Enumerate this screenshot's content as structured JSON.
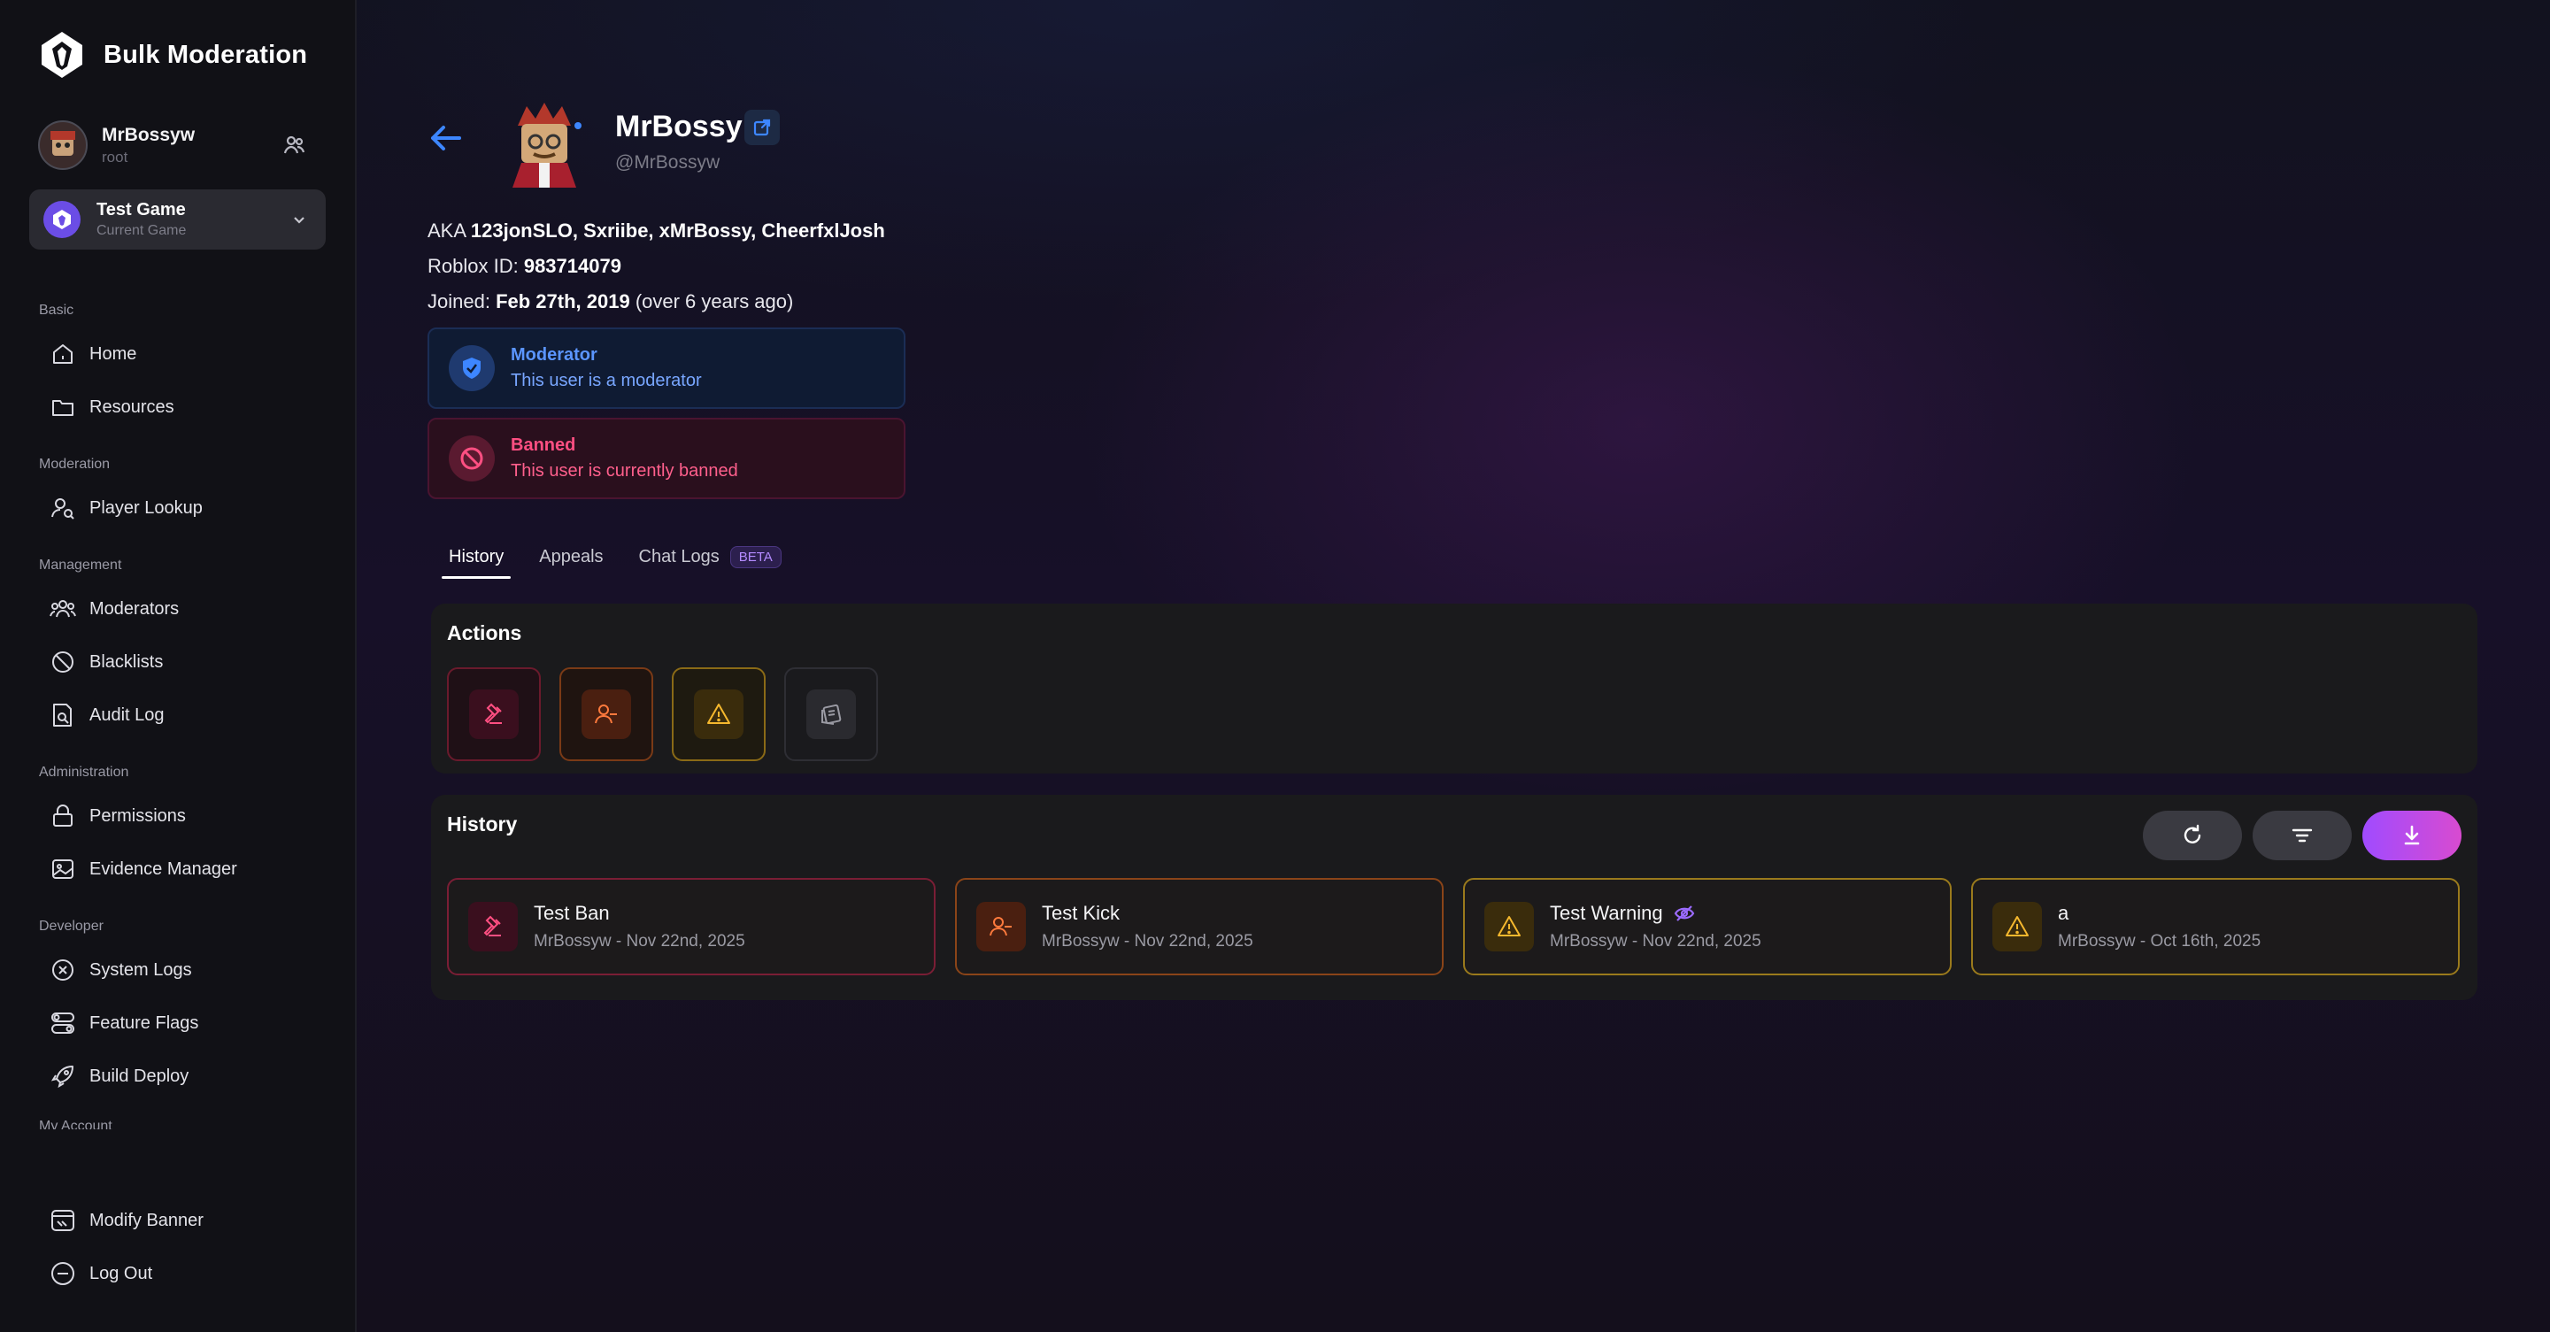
{
  "app": {
    "title": "Bulk Moderation"
  },
  "current_user": {
    "name": "MrBossyw",
    "role": "root"
  },
  "game": {
    "name": "Test Game",
    "subtitle": "Current Game"
  },
  "sidebar": {
    "sections": [
      {
        "label": "Basic",
        "items": [
          {
            "label": "Home",
            "icon": "home-icon"
          },
          {
            "label": "Resources",
            "icon": "folder-icon"
          }
        ]
      },
      {
        "label": "Moderation",
        "items": [
          {
            "label": "Player Lookup",
            "icon": "user-search-icon"
          }
        ]
      },
      {
        "label": "Management",
        "items": [
          {
            "label": "Moderators",
            "icon": "users-icon"
          },
          {
            "label": "Blacklists",
            "icon": "ban-icon"
          },
          {
            "label": "Audit Log",
            "icon": "audit-icon"
          }
        ]
      },
      {
        "label": "Administration",
        "items": [
          {
            "label": "Permissions",
            "icon": "lock-icon"
          },
          {
            "label": "Evidence Manager",
            "icon": "image-icon"
          }
        ]
      },
      {
        "label": "Developer",
        "items": [
          {
            "label": "System Logs",
            "icon": "x-circle-icon"
          },
          {
            "label": "Feature Flags",
            "icon": "toggles-icon"
          },
          {
            "label": "Build Deploy",
            "icon": "rocket-icon"
          }
        ]
      },
      {
        "label": "My Account",
        "items": []
      }
    ],
    "bottom_items": [
      {
        "label": "Modify Banner",
        "icon": "banner-icon"
      },
      {
        "label": "Log Out",
        "icon": "logout-icon"
      }
    ]
  },
  "profile": {
    "display_name": "MrBossy",
    "handle": "@MrBossyw",
    "aka_prefix": "AKA ",
    "aka_names": "123jonSLO, Sxriibe, xMrBossy, CheerfxlJosh",
    "roblox_id_label": "Roblox ID: ",
    "roblox_id": "983714079",
    "joined_label": "Joined: ",
    "joined_date": "Feb 27th, 2019",
    "joined_relative": " (over 6 years ago)"
  },
  "statuses": {
    "moderator": {
      "title": "Moderator",
      "description": "This user is a moderator",
      "color": "#5b95ff"
    },
    "banned": {
      "title": "Banned",
      "description": "This user is currently banned",
      "color": "#ff4f82"
    }
  },
  "tabs": [
    {
      "label": "History",
      "active": true
    },
    {
      "label": "Appeals"
    },
    {
      "label": "Chat Logs",
      "badge": "BETA"
    }
  ],
  "actions_panel": {
    "title": "Actions",
    "buttons": [
      "ban-action",
      "kick-action",
      "warn-action",
      "note-action"
    ]
  },
  "history_panel": {
    "title": "History",
    "entries": [
      {
        "title": "Test Ban",
        "subtitle": "MrBossyw - Nov 22nd, 2025",
        "type": "ban"
      },
      {
        "title": "Test Kick",
        "subtitle": "MrBossyw - Nov 22nd, 2025",
        "type": "kick"
      },
      {
        "title": "Test Warning",
        "subtitle": "MrBossyw - Nov 22nd, 2025",
        "type": "warning",
        "hidden": true
      },
      {
        "title": "a",
        "subtitle": "MrBossyw - Oct 16th, 2025",
        "type": "warning"
      }
    ]
  }
}
